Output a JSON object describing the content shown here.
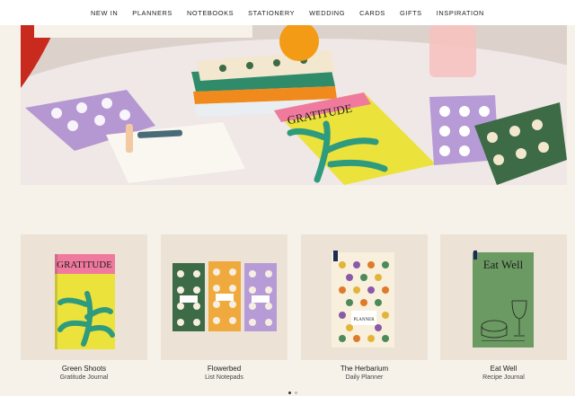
{
  "nav": {
    "items": [
      "NEW IN",
      "PLANNERS",
      "NOTEBOOKS",
      "STATIONERY",
      "WEDDING",
      "CARDS",
      "GIFTS",
      "INSPIRATION"
    ]
  },
  "hero": {
    "book_title": "GRATITUDE",
    "colors": {
      "wall": "#d9cfc8",
      "table": "#ede6e4",
      "yellow": "#e8e23a",
      "green": "#2e9a7e",
      "lilac": "#b69bd6",
      "forest": "#3c6b45",
      "pink": "#f07a9e",
      "orange": "#f08a1c"
    }
  },
  "products": [
    {
      "name": "Green Shoots",
      "type": "Gratitude Journal",
      "cover_text": "GRATITUDE",
      "icon": "gratitude-journal-image"
    },
    {
      "name": "Flowerbed",
      "type": "List Notepads",
      "icon": "notepads-image"
    },
    {
      "name": "The Herbarium",
      "type": "Daily Planner",
      "cover_text": "PLANNER",
      "icon": "planner-image"
    },
    {
      "name": "Eat Well",
      "type": "Recipe Journal",
      "cover_text": "Eat Well",
      "icon": "recipe-journal-image"
    }
  ]
}
